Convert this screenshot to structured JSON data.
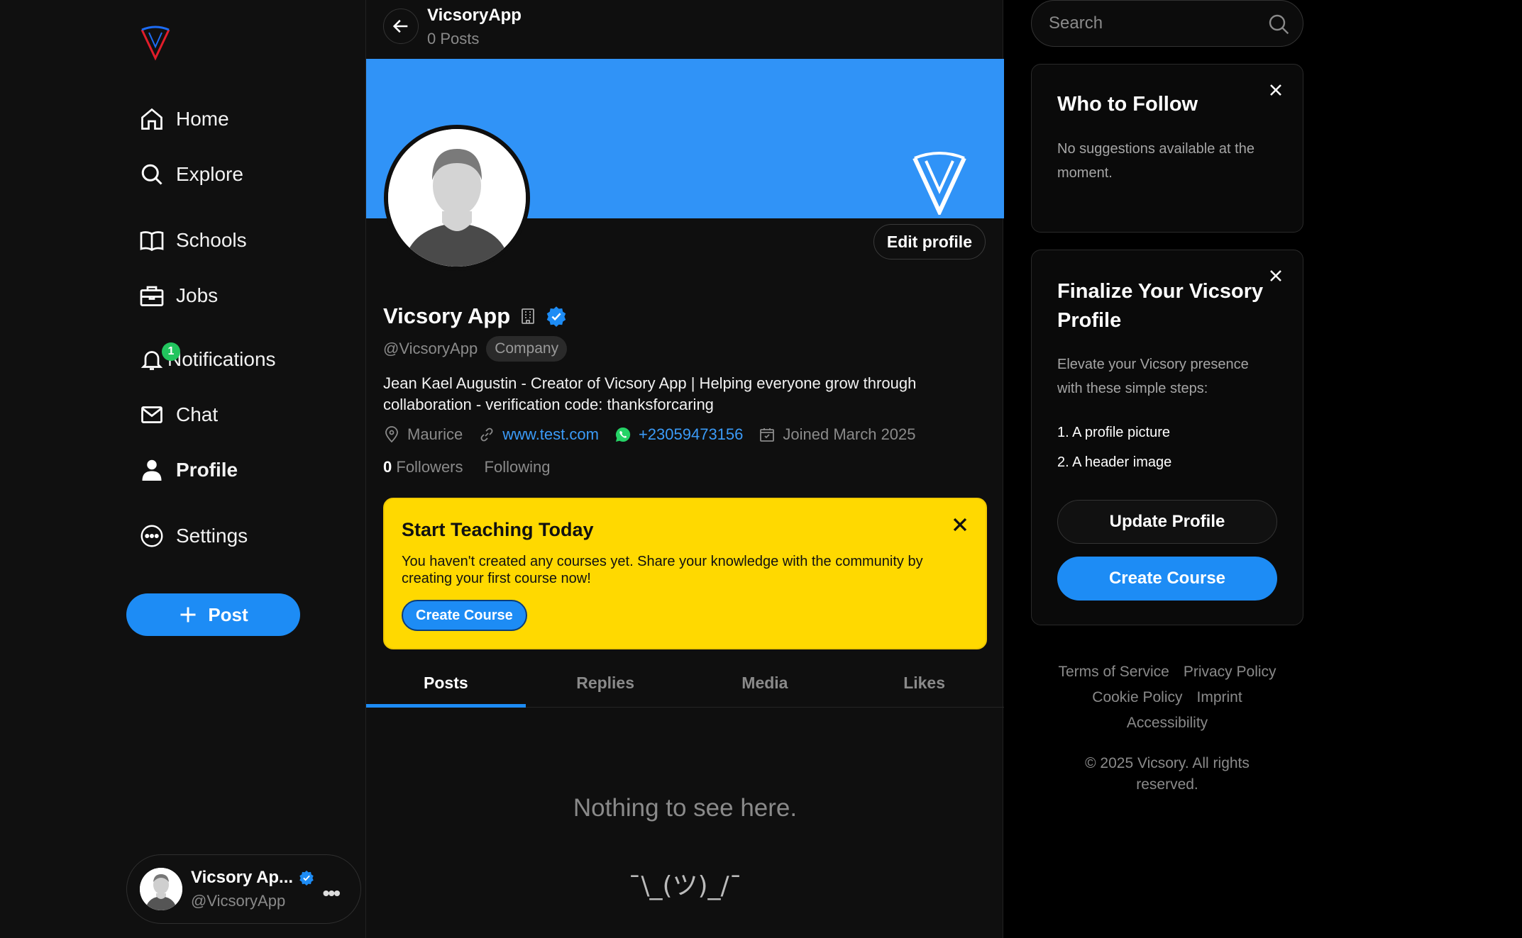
{
  "sidebar": {
    "nav": [
      {
        "label": "Home",
        "icon": "home-icon"
      },
      {
        "label": "Explore",
        "icon": "search-icon"
      },
      {
        "label": "Schools",
        "icon": "book-icon"
      },
      {
        "label": "Jobs",
        "icon": "briefcase-icon"
      },
      {
        "label": "Notifications",
        "icon": "bell-icon",
        "badge": "1"
      },
      {
        "label": "Chat",
        "icon": "mail-icon"
      },
      {
        "label": "Profile",
        "icon": "user-icon",
        "active": true
      },
      {
        "label": "Settings",
        "icon": "more-circle-icon"
      }
    ],
    "post_label": "Post",
    "account": {
      "name": "Vicsory Ap...",
      "handle": "@VicsoryApp",
      "more": "•••"
    }
  },
  "header": {
    "title": "VicsoryApp",
    "subtitle": "0 Posts"
  },
  "profile": {
    "edit_label": "Edit profile",
    "name": "Vicsory App",
    "handle": "@VicsoryApp",
    "badge": "Company",
    "bio": "Jean Kael Augustin - Creator of Vicsory App | Helping everyone grow through collaboration - verification code: thanksforcaring",
    "location": "Maurice",
    "website": "www.test.com",
    "phone": "+23059473156",
    "joined": "Joined March 2025",
    "followers_count": "0",
    "followers_label": "Followers",
    "following_label": "Following"
  },
  "promo": {
    "title": "Start Teaching Today",
    "text": "You haven't created any courses yet. Share your knowledge with the community by creating your first course now!",
    "button": "Create Course"
  },
  "tabs": [
    "Posts",
    "Replies",
    "Media",
    "Likes"
  ],
  "empty": {
    "message": "Nothing to see here.",
    "shrug": "¯\\_(ツ)_/¯"
  },
  "search": {
    "placeholder": "Search"
  },
  "who_to_follow": {
    "title": "Who to Follow",
    "body": "No suggestions available at the moment."
  },
  "finalize": {
    "title": "Finalize Your Vicsory Profile",
    "body": "Elevate your Vicsory presence with these simple steps:",
    "steps": [
      "1. A profile picture",
      "2. A header image"
    ],
    "update_label": "Update Profile",
    "create_label": "Create Course"
  },
  "footer": {
    "links": [
      "Terms of Service",
      "Privacy Policy",
      "Cookie Policy",
      "Imprint",
      "Accessibility"
    ],
    "copyright": "© 2025 Vicsory. All rights reserved."
  },
  "colors": {
    "accent": "#1d8cf5",
    "banner": "#3093f7",
    "promo": "#ffd900",
    "notif": "#22c55e"
  }
}
